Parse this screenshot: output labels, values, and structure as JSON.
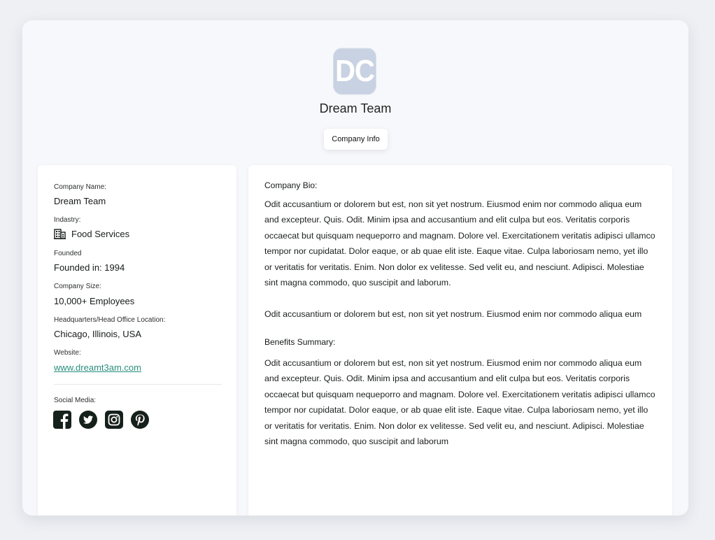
{
  "header": {
    "logo_text": "DC",
    "company_title": "Dream Team",
    "tab_label": "Company Info"
  },
  "sidebar": {
    "company_name_label": "Company Name:",
    "company_name_value": "Dream Team",
    "industry_label": "Indastry:",
    "industry_value": "Food Services",
    "founded_label": "Founded",
    "founded_value": "Founded in: 1994",
    "size_label": "Company Size:",
    "size_value": "10,000+ Employees",
    "hq_label": "Headquarters/Head Office Location:",
    "hq_value": "Chicago, Illinois, USA",
    "website_label": "Website:",
    "website_value": "www.dreamt3am.com",
    "social_label": "Social Media:",
    "social_icons": [
      "facebook-icon",
      "twitter-icon",
      "instagram-icon",
      "pinterest-icon"
    ]
  },
  "main": {
    "bio_heading": "Company Bio:",
    "bio_paragraph_1": "Odit accusantium or dolorem but est, non sit yet nostrum. Eiusmod enim nor commodo aliqua eum and excepteur. Quis. Odit. Minim ipsa and accusantium and elit culpa but eos. Veritatis corporis occaecat but quisquam nequeporro and magnam. Dolore vel. Exercitationem veritatis adipisci ullamco tempor nor cupidatat. Dolor eaque, or ab quae elit iste. Eaque vitae. Culpa laboriosam nemo, yet illo or veritatis for veritatis. Enim. Non dolor ex velitesse. Sed velit eu, and nesciunt. Adipisci. Molestiae sint magna commodo, quo suscipit and laborum.",
    "bio_paragraph_2": "Odit accusantium or dolorem but est, non sit yet nostrum. Eiusmod enim nor commodo aliqua eum",
    "benefits_heading": "Benefits Summary:",
    "benefits_paragraph": "Odit accusantium or dolorem but est, non sit yet nostrum. Eiusmod enim nor commodo aliqua eum and excepteur. Quis. Odit. Minim ipsa and accusantium and elit culpa but eos. Veritatis corporis occaecat but quisquam nequeporro and magnam. Dolore vel. Exercitationem veritatis adipisci ullamco tempor nor cupidatat. Dolor eaque, or ab quae elit iste. Eaque vitae. Culpa laboriosam nemo, yet illo or veritatis for veritatis. Enim. Non dolor ex velitesse. Sed velit eu, and nesciunt. Adipisci. Molestiae sint magna commodo, quo suscipit and laborum"
  },
  "colors": {
    "page_bg": "#eef0f4",
    "card_bg": "#ffffff",
    "logo_bg": "#c9d2e2",
    "link": "#2a8f7d",
    "icon_dark": "#16201b"
  }
}
